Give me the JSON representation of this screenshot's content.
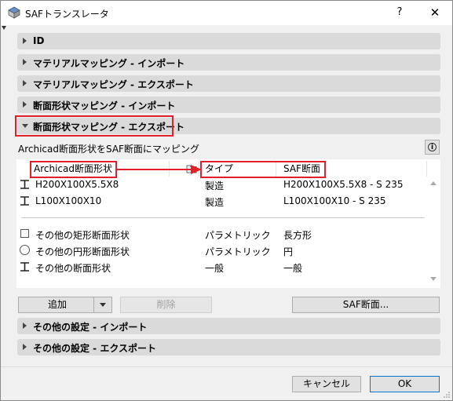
{
  "window": {
    "title": "SAFトランスレータ",
    "help_label": "?",
    "close_label": "✕",
    "app_icon": "saf-translator-icon"
  },
  "sections": [
    {
      "label": "ID",
      "expanded": false
    },
    {
      "label": "マテリアルマッピング - インポート",
      "expanded": false
    },
    {
      "label": "マテリアルマッピング - エクスポート",
      "expanded": false
    },
    {
      "label": "断面形状マッピング - インポート",
      "expanded": false
    },
    {
      "label": "断面形状マッピング - エクスポート",
      "expanded": true
    }
  ],
  "mapping": {
    "description": "Archicad断面形状をSAF断面にマッピング",
    "info_label": "i",
    "columns": {
      "archicad_profile": "Archicad断面形状",
      "type": "タイプ",
      "saf_section": "SAF断面"
    },
    "rows": [
      {
        "icon": "i-beam-icon",
        "name": "H200X100X5.5X8",
        "type": "製造",
        "saf": "H200X100X5.5X8 - S 235"
      },
      {
        "icon": "i-beam-icon",
        "name": "L100X100X10",
        "type": "製造",
        "saf": "L100X100X10 - S 235"
      }
    ],
    "other_rows": [
      {
        "icon": "rectangle-icon",
        "name": "その他の矩形断面形状",
        "type": "パラメトリック",
        "saf": "長方形"
      },
      {
        "icon": "circle-icon",
        "name": "その他の円形断面形状",
        "type": "パラメトリック",
        "saf": "円"
      },
      {
        "icon": "i-beam-icon",
        "name": "その他の断面形状",
        "type": "一般",
        "saf": "一般"
      }
    ]
  },
  "buttons": {
    "add": "追加",
    "delete": "削除",
    "saf_section": "SAF断面..."
  },
  "bottom_sections": [
    {
      "label": "その他の設定 - インポート",
      "expanded": false
    },
    {
      "label": "その他の設定 - エクスポート",
      "expanded": false
    }
  ],
  "footer": {
    "cancel": "キャンセル",
    "ok": "OK"
  },
  "colors": {
    "highlight": "#e0202a",
    "section_bg": "#dadada",
    "primary_border": "#0078d7"
  }
}
